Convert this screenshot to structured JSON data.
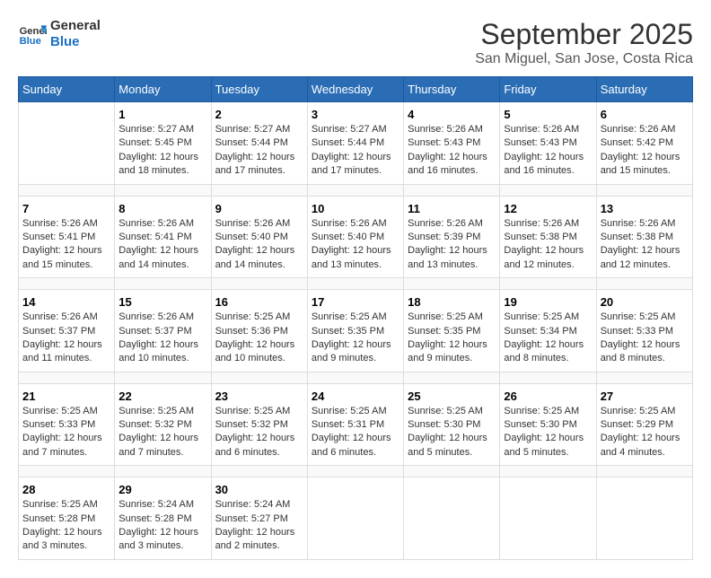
{
  "header": {
    "logo_line1": "General",
    "logo_line2": "Blue",
    "month": "September 2025",
    "location": "San Miguel, San Jose, Costa Rica"
  },
  "weekdays": [
    "Sunday",
    "Monday",
    "Tuesday",
    "Wednesday",
    "Thursday",
    "Friday",
    "Saturday"
  ],
  "weeks": [
    [
      {
        "day": "",
        "info": ""
      },
      {
        "day": "1",
        "info": "Sunrise: 5:27 AM\nSunset: 5:45 PM\nDaylight: 12 hours\nand 18 minutes."
      },
      {
        "day": "2",
        "info": "Sunrise: 5:27 AM\nSunset: 5:44 PM\nDaylight: 12 hours\nand 17 minutes."
      },
      {
        "day": "3",
        "info": "Sunrise: 5:27 AM\nSunset: 5:44 PM\nDaylight: 12 hours\nand 17 minutes."
      },
      {
        "day": "4",
        "info": "Sunrise: 5:26 AM\nSunset: 5:43 PM\nDaylight: 12 hours\nand 16 minutes."
      },
      {
        "day": "5",
        "info": "Sunrise: 5:26 AM\nSunset: 5:43 PM\nDaylight: 12 hours\nand 16 minutes."
      },
      {
        "day": "6",
        "info": "Sunrise: 5:26 AM\nSunset: 5:42 PM\nDaylight: 12 hours\nand 15 minutes."
      }
    ],
    [
      {
        "day": "7",
        "info": "Sunrise: 5:26 AM\nSunset: 5:41 PM\nDaylight: 12 hours\nand 15 minutes."
      },
      {
        "day": "8",
        "info": "Sunrise: 5:26 AM\nSunset: 5:41 PM\nDaylight: 12 hours\nand 14 minutes."
      },
      {
        "day": "9",
        "info": "Sunrise: 5:26 AM\nSunset: 5:40 PM\nDaylight: 12 hours\nand 14 minutes."
      },
      {
        "day": "10",
        "info": "Sunrise: 5:26 AM\nSunset: 5:40 PM\nDaylight: 12 hours\nand 13 minutes."
      },
      {
        "day": "11",
        "info": "Sunrise: 5:26 AM\nSunset: 5:39 PM\nDaylight: 12 hours\nand 13 minutes."
      },
      {
        "day": "12",
        "info": "Sunrise: 5:26 AM\nSunset: 5:38 PM\nDaylight: 12 hours\nand 12 minutes."
      },
      {
        "day": "13",
        "info": "Sunrise: 5:26 AM\nSunset: 5:38 PM\nDaylight: 12 hours\nand 12 minutes."
      }
    ],
    [
      {
        "day": "14",
        "info": "Sunrise: 5:26 AM\nSunset: 5:37 PM\nDaylight: 12 hours\nand 11 minutes."
      },
      {
        "day": "15",
        "info": "Sunrise: 5:26 AM\nSunset: 5:37 PM\nDaylight: 12 hours\nand 10 minutes."
      },
      {
        "day": "16",
        "info": "Sunrise: 5:25 AM\nSunset: 5:36 PM\nDaylight: 12 hours\nand 10 minutes."
      },
      {
        "day": "17",
        "info": "Sunrise: 5:25 AM\nSunset: 5:35 PM\nDaylight: 12 hours\nand 9 minutes."
      },
      {
        "day": "18",
        "info": "Sunrise: 5:25 AM\nSunset: 5:35 PM\nDaylight: 12 hours\nand 9 minutes."
      },
      {
        "day": "19",
        "info": "Sunrise: 5:25 AM\nSunset: 5:34 PM\nDaylight: 12 hours\nand 8 minutes."
      },
      {
        "day": "20",
        "info": "Sunrise: 5:25 AM\nSunset: 5:33 PM\nDaylight: 12 hours\nand 8 minutes."
      }
    ],
    [
      {
        "day": "21",
        "info": "Sunrise: 5:25 AM\nSunset: 5:33 PM\nDaylight: 12 hours\nand 7 minutes."
      },
      {
        "day": "22",
        "info": "Sunrise: 5:25 AM\nSunset: 5:32 PM\nDaylight: 12 hours\nand 7 minutes."
      },
      {
        "day": "23",
        "info": "Sunrise: 5:25 AM\nSunset: 5:32 PM\nDaylight: 12 hours\nand 6 minutes."
      },
      {
        "day": "24",
        "info": "Sunrise: 5:25 AM\nSunset: 5:31 PM\nDaylight: 12 hours\nand 6 minutes."
      },
      {
        "day": "25",
        "info": "Sunrise: 5:25 AM\nSunset: 5:30 PM\nDaylight: 12 hours\nand 5 minutes."
      },
      {
        "day": "26",
        "info": "Sunrise: 5:25 AM\nSunset: 5:30 PM\nDaylight: 12 hours\nand 5 minutes."
      },
      {
        "day": "27",
        "info": "Sunrise: 5:25 AM\nSunset: 5:29 PM\nDaylight: 12 hours\nand 4 minutes."
      }
    ],
    [
      {
        "day": "28",
        "info": "Sunrise: 5:25 AM\nSunset: 5:28 PM\nDaylight: 12 hours\nand 3 minutes."
      },
      {
        "day": "29",
        "info": "Sunrise: 5:24 AM\nSunset: 5:28 PM\nDaylight: 12 hours\nand 3 minutes."
      },
      {
        "day": "30",
        "info": "Sunrise: 5:24 AM\nSunset: 5:27 PM\nDaylight: 12 hours\nand 2 minutes."
      },
      {
        "day": "",
        "info": ""
      },
      {
        "day": "",
        "info": ""
      },
      {
        "day": "",
        "info": ""
      },
      {
        "day": "",
        "info": ""
      }
    ]
  ]
}
